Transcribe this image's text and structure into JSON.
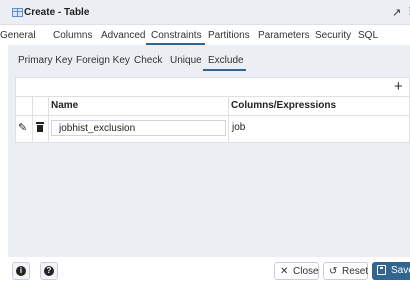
{
  "titlebar": {
    "title": "Create - Table",
    "icon": "table-icon",
    "expand_icon": "↗",
    "more_icon": "⋮"
  },
  "tabs": [
    {
      "label": "General"
    },
    {
      "label": "Columns"
    },
    {
      "label": "Advanced"
    },
    {
      "label": "Constraints",
      "active": true
    },
    {
      "label": "Partitions"
    },
    {
      "label": "Parameters"
    },
    {
      "label": "Security"
    },
    {
      "label": "SQL"
    }
  ],
  "subtabs": [
    {
      "label": "Primary Key"
    },
    {
      "label": "Foreign Key"
    },
    {
      "label": "Check"
    },
    {
      "label": "Unique"
    },
    {
      "label": "Exclude",
      "active": true
    }
  ],
  "grid": {
    "add_symbol": "+",
    "columns": [
      "Name",
      "Columns/Expressions"
    ],
    "rows": [
      {
        "name": "jobhist_exclusion",
        "columns": "job"
      }
    ]
  },
  "footer": {
    "info_symbol": "i",
    "help_symbol": "?",
    "close_label": "Close",
    "reset_label": "Reset",
    "save_label": "Save"
  },
  "colors": {
    "accent": "#326690",
    "panel_bg": "#ebeef3",
    "border": "#dde0e6"
  }
}
